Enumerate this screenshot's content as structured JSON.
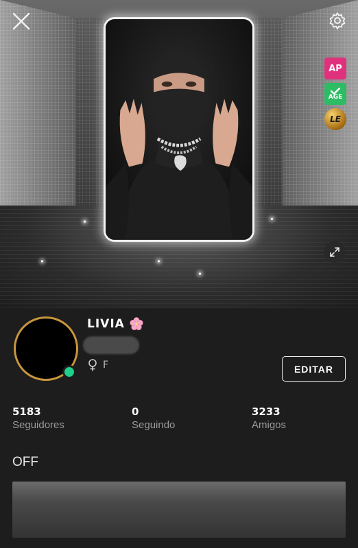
{
  "header": {
    "close_icon": "close-icon",
    "settings_icon": "gear-icon",
    "expand_icon": "expand-icon",
    "badges": [
      {
        "label": "AP",
        "color": "#e0317d"
      },
      {
        "label": "AGE",
        "color": "#2dbb63"
      },
      {
        "label": "LE",
        "color": "#c99425"
      }
    ]
  },
  "profile": {
    "name": "LIVIA",
    "gender_icon": "female-icon",
    "gender_label": "F",
    "online_color": "#1fd08a",
    "avatar_ring_color": "#c8963e"
  },
  "actions": {
    "edit_label": "EDITAR"
  },
  "stats": [
    {
      "value": "5183",
      "label": "Seguidores"
    },
    {
      "value": "0",
      "label": "Seguindo"
    },
    {
      "value": "3233",
      "label": "Amigos"
    }
  ],
  "status": {
    "text": "OFF"
  }
}
